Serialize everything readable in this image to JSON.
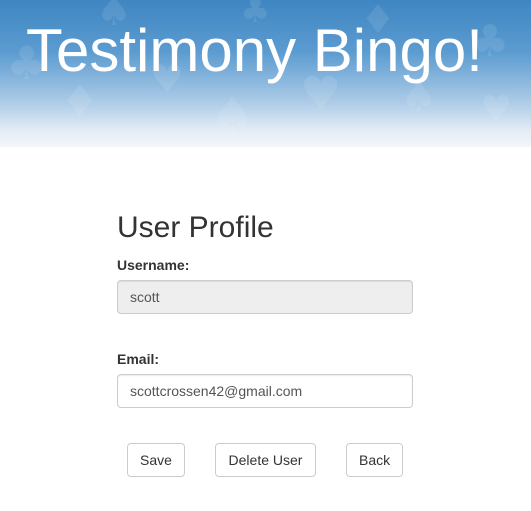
{
  "header": {
    "title": "Testimony Bingo!"
  },
  "profile": {
    "title": "User Profile",
    "username_label": "Username:",
    "username_value": "scott",
    "email_label": "Email:",
    "email_value": "scottcrossen42@gmail.com"
  },
  "actions": {
    "save_label": "Save",
    "delete_label": "Delete User",
    "back_label": "Back"
  },
  "colors": {
    "banner_top": "#3f86c2",
    "banner_bottom": "#f3f5f8",
    "readonly_background": "#eeeeee"
  }
}
